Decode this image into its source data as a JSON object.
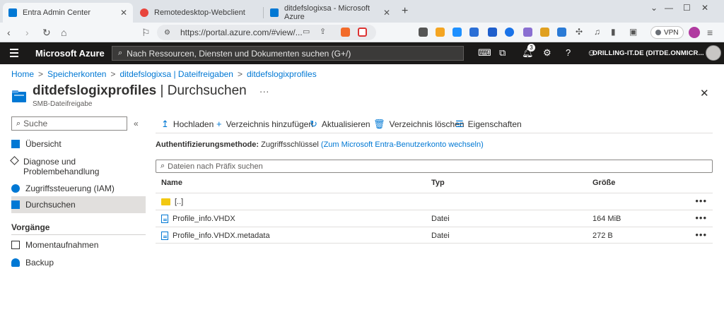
{
  "browser": {
    "tabs": [
      {
        "title": "Entra Admin Center",
        "color": "#0078d4"
      },
      {
        "title": "Remotedesktop-Webclient",
        "color": "#e8453c"
      },
      {
        "title": "ditdefslogixsa - Microsoft Azure",
        "color": "#0078d4"
      }
    ],
    "url": "https://portal.azure.com/#view/...",
    "vpn_label": "VPN"
  },
  "portal": {
    "brand": "Microsoft Azure",
    "search_placeholder": "Nach Ressourcen, Diensten und Dokumenten suchen (G+/)",
    "notification_count": "3",
    "tenant": "DRILLING-IT.DE (DITDE.ONMICR..."
  },
  "breadcrumb": [
    "Home",
    "Speicherkonten",
    "ditdefslogixsa | Dateifreigaben",
    "ditdefslogixprofiles"
  ],
  "header": {
    "resource": "ditdefslogixprofiles",
    "separator": " | ",
    "blade": "Durchsuchen",
    "more": "···",
    "subtitle": "SMB-Dateifreigabe"
  },
  "menu": {
    "search_placeholder": "Suche",
    "collapse": "«",
    "items": [
      {
        "label": "Übersicht"
      },
      {
        "label": "Diagnose und Problembehandlung"
      },
      {
        "label": "Zugriffssteuerung (IAM)"
      },
      {
        "label": "Durchsuchen"
      }
    ],
    "group": "Vorgänge",
    "group_items": [
      {
        "label": "Momentaufnahmen"
      },
      {
        "label": "Backup"
      }
    ]
  },
  "commands": [
    {
      "label": "Hochladen"
    },
    {
      "label": "Verzeichnis hinzufügen"
    },
    {
      "label": "Aktualisieren"
    },
    {
      "label": "Verzeichnis löschen"
    },
    {
      "label": "Eigenschaften"
    }
  ],
  "auth": {
    "label": "Authentifizierungsmethode:",
    "value": "Zugriffsschlüssel",
    "link": "(Zum Microsoft Entra-Benutzerkonto wechseln)"
  },
  "prefix_search_placeholder": "Dateien nach Präfix suchen",
  "table": {
    "columns": [
      "Name",
      "Typ",
      "Größe"
    ],
    "rows": [
      {
        "name": "[..]",
        "type": "",
        "size": ""
      },
      {
        "name": "Profile_info.VHDX",
        "type": "Datei",
        "size": "164 MiB"
      },
      {
        "name": "Profile_info.VHDX.metadata",
        "type": "Datei",
        "size": "272 B"
      }
    ],
    "row_menu": "•••"
  }
}
